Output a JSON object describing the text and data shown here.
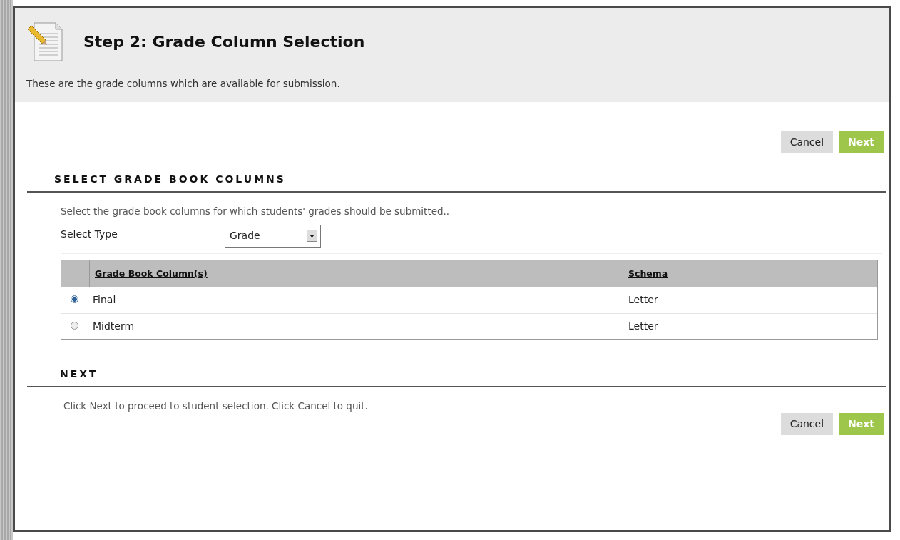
{
  "header": {
    "title": "Step 2: Grade Column Selection",
    "description": "These are the grade columns which are available for submission."
  },
  "top_buttons": [
    {
      "label": "Cancel",
      "kind": "secondary"
    },
    {
      "label": "Next",
      "kind": "primary"
    }
  ],
  "section": {
    "heading": "SELECT GRADE BOOK COLUMNS",
    "instructions": "Select the grade book columns for which students' grades should be submitted..",
    "type_label": "Select Type",
    "type_value": "Grade"
  },
  "table": {
    "columns": [
      "Grade Book Column(s)",
      "Schema"
    ],
    "rows": [
      {
        "name": "Final",
        "schema": "Letter",
        "selected": true
      },
      {
        "name": "Midterm",
        "schema": "Letter",
        "selected": false
      }
    ]
  },
  "next_section": {
    "heading": "NEXT",
    "instructions": "Click Next to proceed to student selection. Click Cancel to quit."
  },
  "bottom_buttons": [
    {
      "label": "Cancel",
      "kind": "secondary"
    },
    {
      "label": "Next",
      "kind": "primary"
    }
  ]
}
